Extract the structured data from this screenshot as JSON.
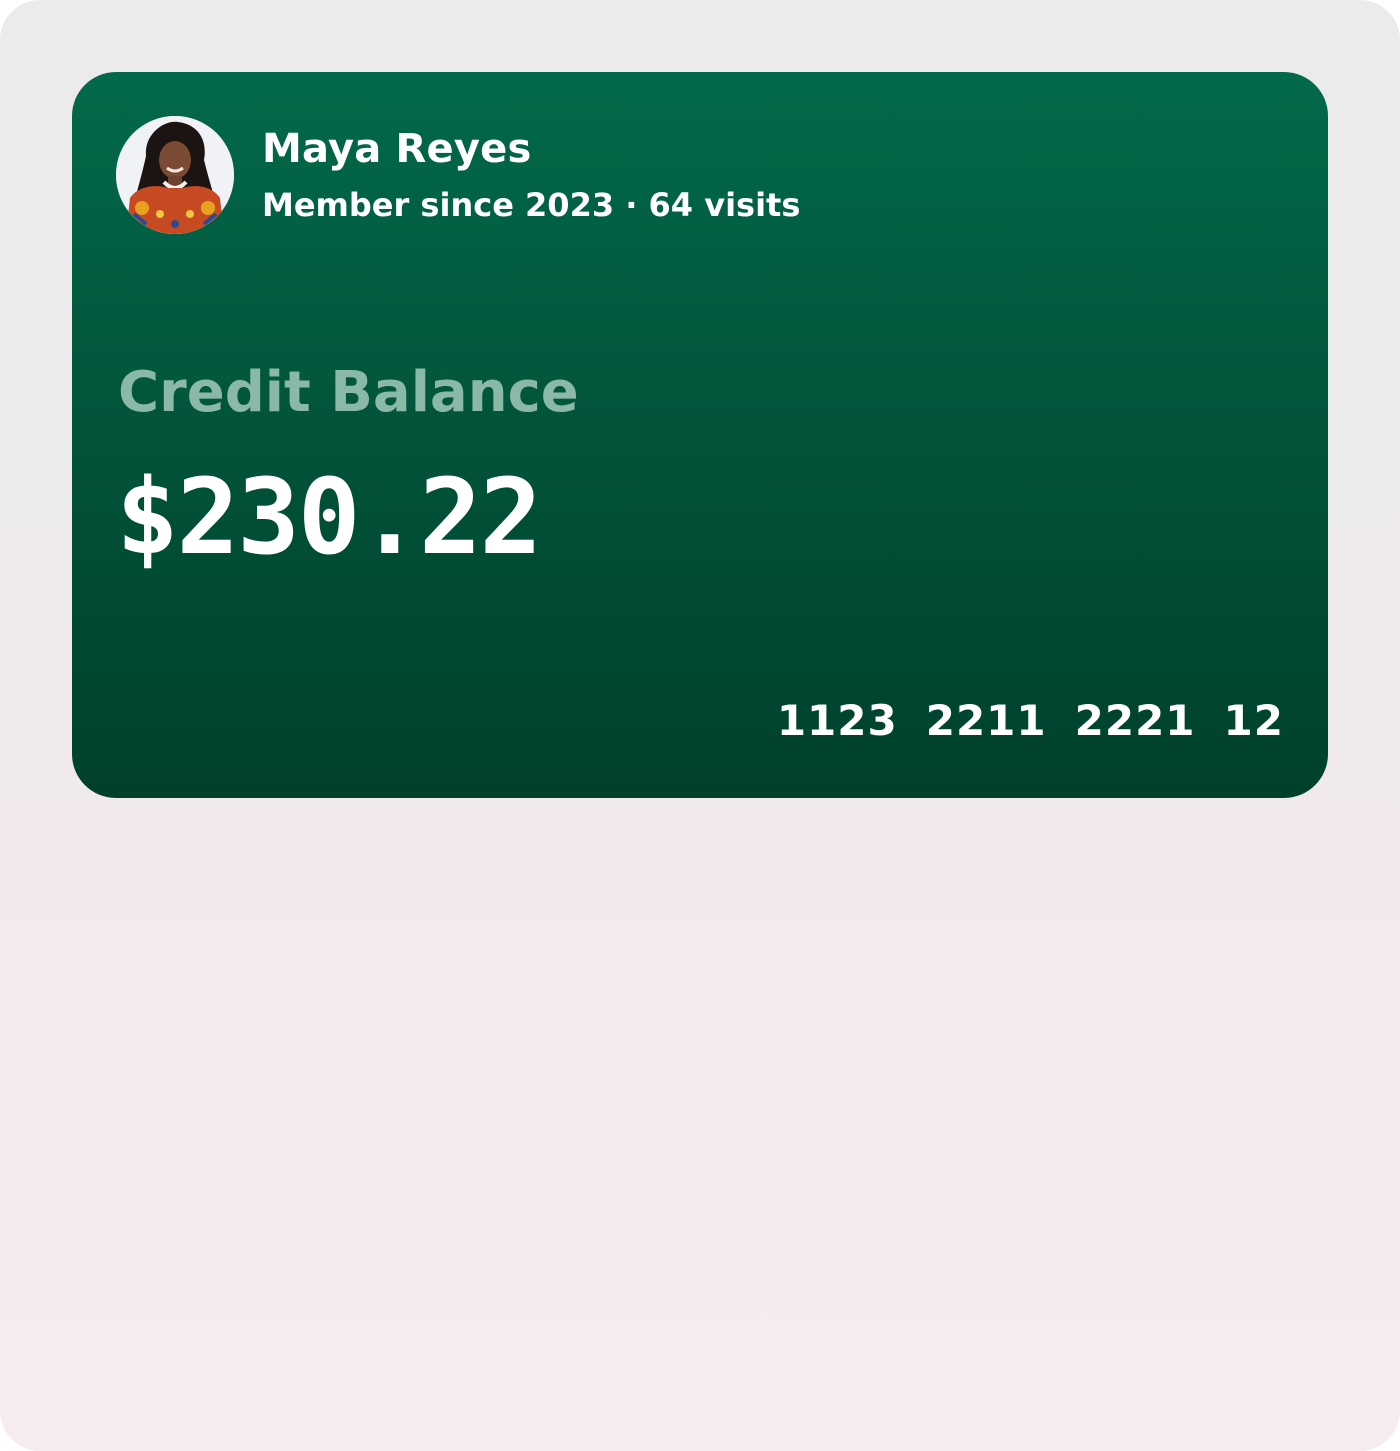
{
  "profile": {
    "name": "Maya Reyes",
    "member_line": "Member since 2023 · 64 visits",
    "avatar_icon": "user-photo"
  },
  "balance": {
    "label": "Credit Balance",
    "amount": "$230.22"
  },
  "card_number_groups": [
    "1123",
    "2211",
    "2221",
    "12"
  ],
  "colors": {
    "card_top": "#03694a",
    "card_bottom": "#01402c",
    "label_muted": "#8bb9a7",
    "text": "#ffffff"
  }
}
